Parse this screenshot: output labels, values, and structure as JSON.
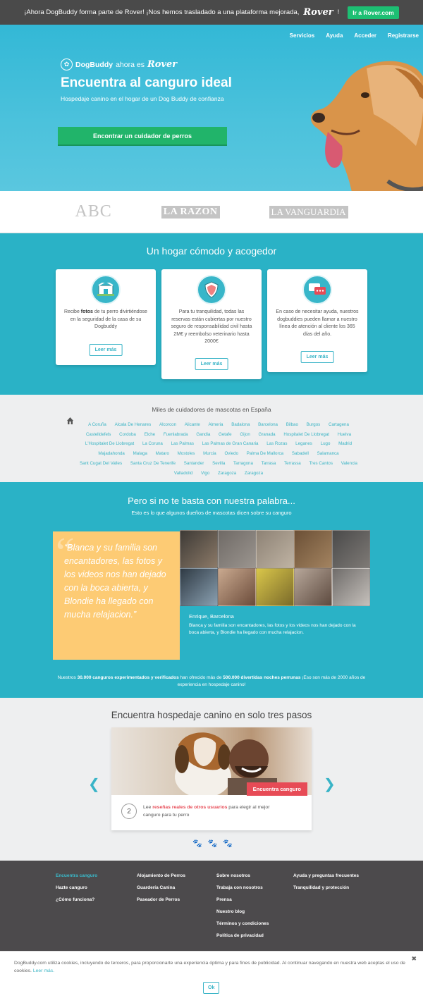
{
  "notice": {
    "text": "¡Ahora DogBuddy forma parte de Rover! ¡Nos hemos trasladado a una plataforma mejorada,",
    "rover": "Rover",
    "rover_suffix": "!",
    "button": "Ir a Rover.com"
  },
  "nav": [
    "Servicios",
    "Ayuda",
    "Acceder",
    "Registrarse"
  ],
  "hero": {
    "brand": "DogBuddy",
    "brand_mid": "ahora es",
    "brand_rover": "Rover",
    "title": "Encuentra al canguro ideal",
    "subtitle": "Hospedaje canino en el hogar de un Dog Buddy de confianza",
    "cta": "Encontrar un cuidador de perros"
  },
  "press": {
    "abc": "ABC",
    "razon": "LA RAZON",
    "vanguardia": "LA VANGUARDIA"
  },
  "features": {
    "title": "Un hogar cómodo y acogedor",
    "cards": [
      {
        "pre": "Recibe ",
        "bold": "fotos",
        "post": " de tu perro divirtiéndose en la seguridad de la casa de su Dogbuddy",
        "button": "Leer más"
      },
      {
        "text": "Para tu tranquilidad, todas las reservas están cubiertas por nuestro seguro de responsabilidad civil hasta 2M€ y reembolso veterinario hasta 2000€",
        "button": "Leer más"
      },
      {
        "text": "En caso de necesitar ayuda, nuestros dogbuddies pueden llamar a nuestro línea de atención al cliente los 365 días del año.",
        "button": "Leer más"
      }
    ]
  },
  "cities": {
    "title": "Miles de cuidadores de mascotas en España",
    "list": [
      "A Coruña",
      "Alcala De Henares",
      "Alcorcon",
      "Alicante",
      "Almeria",
      "Badalona",
      "Barcelona",
      "Bilbao",
      "Burgos",
      "Cartagena",
      "Castelldefels",
      "Cordoba",
      "Elche",
      "Fuenlabrada",
      "Gandia",
      "Getafe",
      "Gijon",
      "Granada",
      "Hospitalet De Llobregat",
      "Huelva",
      "L'Hospitalet De Llobregat",
      "La Coruna",
      "Las Palmas",
      "Las Palmas de Gran Canaria",
      "Las Rozas",
      "Leganes",
      "Lugo",
      "Madrid",
      "Majadahonda",
      "Malaga",
      "Mataro",
      "Mostoles",
      "Murcia",
      "Oviedo",
      "Palma De Mallorca",
      "Sabadell",
      "Salamanca",
      "Sant Cugat Del Valles",
      "Santa Cruz De Tenerife",
      "Santander",
      "Sevilla",
      "Tarragona",
      "Tarrasa",
      "Terrassa",
      "Tres Cantos",
      "Valencia",
      "Valladolid",
      "Vigo",
      "Zaragoza",
      "Zaragoza"
    ]
  },
  "testimonials": {
    "title": "Pero si no te basta con nuestra palabra...",
    "subtitle": "Esto es lo que algunos dueños de mascotas dicen sobre su canguro",
    "quote": "“Blanca y su familia son encantadores, las fotos y los videos nos han dejado con la boca abierta, y Blondie ha llegado con mucha relajacion.”",
    "person": "Enrique, Barcelona",
    "text": "Blanca y su familia son encantadores, las fotos y los videos nos han dejado con la boca abierta, y Blondie ha llegado con mucha relajacion.",
    "stats": {
      "p1": "Nuestros ",
      "b1": "30.000 canguros experimentados y verificados",
      "p2": " han ofrecido más de ",
      "b2": "500.000 divertidas noches perrunas",
      "p3": " ¡Eso son más de 2000 años de experiencia en hospedaje canino!"
    }
  },
  "steps": {
    "title": "Encuentra hospedaje canino en solo tres pasos",
    "cta": "Encuentra canguro",
    "number": "2",
    "pre": "Lee ",
    "bold": "reseñas reales de otros usuarios",
    "post": " para elegir al mejor canguro para tu perro"
  },
  "footer": {
    "col1": [
      "Encuentra canguro",
      "Hazte canguro",
      "¿Cómo funciona?"
    ],
    "col2": [
      "Alojamiento de Perros",
      "Guardería Canina",
      "Paseador de Perros"
    ],
    "col3": [
      "Sobre nosotros",
      "Trabaja con nosotros",
      "Prensa",
      "Nuestro blog",
      "Términos y condiciones",
      "Política de privacidad"
    ],
    "col4": [
      "Ayuda y preguntas frecuentes",
      "Tranquilidad y protección"
    ]
  },
  "cookie": {
    "text": "DogBuddy.com utiliza cookies, incluyendo de terceros, para proporcionarte una experiencia óptima y para fines de publicidad. Al continuar navegando en nuestra web aceptas el uso de cookies. ",
    "link": "Leer más.",
    "button": "Ok",
    "close": "✖"
  },
  "colors": {
    "teal": "#2ab2c6",
    "green": "#21b46a",
    "red": "#e74b56",
    "yellow": "#fdcb74",
    "footer": "#4c4a4c"
  }
}
